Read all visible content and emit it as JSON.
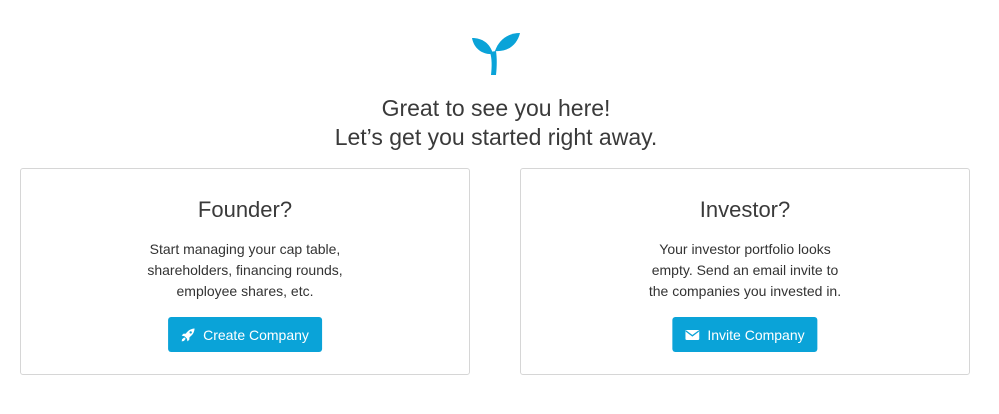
{
  "brand": {
    "logo_icon": "sprout-icon",
    "accent_color": "#0aa3d8"
  },
  "welcome": {
    "line1": "Great to see you here!",
    "line2": "Let’s get you started right away."
  },
  "founder_card": {
    "title": "Founder?",
    "description_lines": [
      "Start managing your cap table,",
      "shareholders, financing rounds,",
      "employee shares, etc."
    ],
    "button_label": "Create Company",
    "button_icon": "rocket-icon"
  },
  "investor_card": {
    "title": "Investor?",
    "description_lines": [
      "Your investor portfolio looks",
      "empty. Send an email invite to",
      "the companies you invested in."
    ],
    "button_label": "Invite Company",
    "button_icon": "envelope-icon"
  }
}
